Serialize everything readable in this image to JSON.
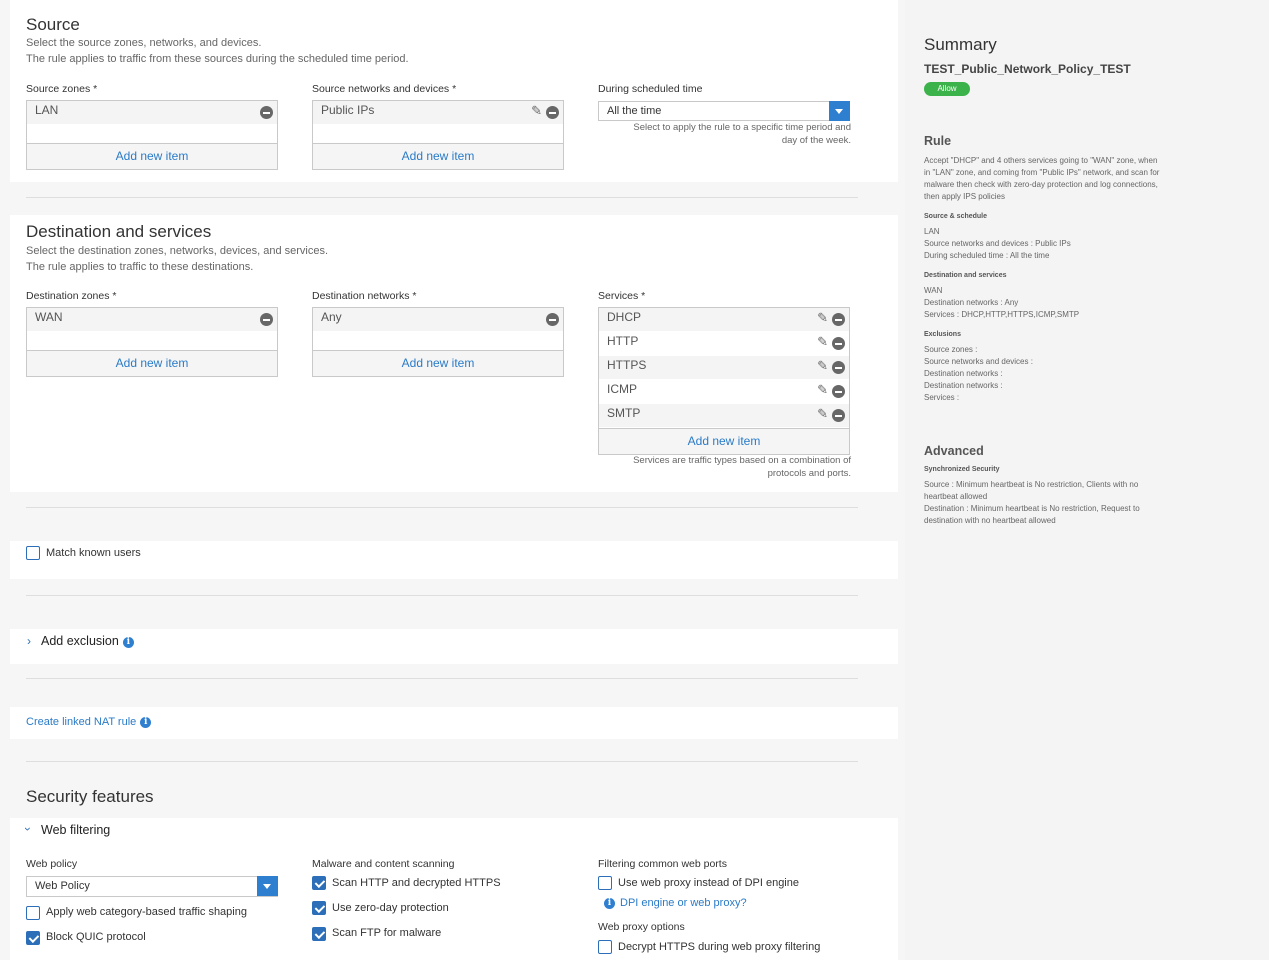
{
  "source": {
    "title": "Source",
    "desc1": "Select the source zones, networks, and devices.",
    "desc2": "The rule applies to traffic from these sources during the scheduled time period.",
    "zones_label": "Source zones *",
    "zones": [
      "LAN"
    ],
    "networks_label": "Source networks and devices *",
    "networks": [
      "Public IPs"
    ],
    "schedule_label": "During scheduled time",
    "schedule_value": "All the time",
    "schedule_hint": "Select to apply the rule to a specific time period and day of the week.",
    "add_new": "Add new item"
  },
  "destination": {
    "title": "Destination and services",
    "desc1": "Select the destination zones, networks, devices, and services.",
    "desc2": "The rule applies to traffic to these destinations.",
    "zones_label": "Destination zones *",
    "zones": [
      "WAN"
    ],
    "networks_label": "Destination networks *",
    "networks": [
      "Any"
    ],
    "services_label": "Services *",
    "services": [
      "DHCP",
      "HTTP",
      "HTTPS",
      "ICMP",
      "SMTP"
    ],
    "services_hint": "Services are traffic types based on a combination of protocols and ports.",
    "add_new": "Add new item"
  },
  "match_known_users": {
    "label": "Match known users",
    "checked": false
  },
  "exclusion": {
    "label": "Add exclusion"
  },
  "nat": {
    "label": "Create linked NAT rule"
  },
  "security": {
    "title": "Security features",
    "web_filtering": "Web filtering",
    "web_policy_label": "Web policy",
    "web_policy_value": "Web Policy",
    "apply_shaping": "Apply web category-based traffic shaping",
    "block_quic": "Block QUIC protocol",
    "malware_label": "Malware and content scanning",
    "scan_http": "Scan HTTP and decrypted HTTPS",
    "zero_day": "Use zero-day protection",
    "scan_ftp": "Scan FTP for malware",
    "ports_label": "Filtering common web ports",
    "use_proxy": "Use web proxy instead of DPI engine",
    "dpi_link": "DPI engine or web proxy?",
    "proxy_options_label": "Web proxy options",
    "decrypt_https": "Decrypt HTTPS during web proxy filtering"
  },
  "summary": {
    "title": "Summary",
    "rule_name": "TEST_Public_Network_Policy_TEST",
    "badge": "Allow",
    "rule_heading": "Rule",
    "rule_text": "Accept \"DHCP\" and 4 others services going to \"WAN\" zone, when in \"LAN\" zone, and coming from \"Public IPs\" network, and scan for malware then check with zero-day protection and log connections, then apply IPS policies",
    "src_sched_heading": "Source & schedule",
    "src_lines": [
      "LAN",
      "Source networks and devices : Public IPs",
      "During scheduled time : All the time"
    ],
    "dst_heading": "Destination and services",
    "dst_lines": [
      "WAN",
      "Destination networks : Any",
      "Services : DHCP,HTTP,HTTPS,ICMP,SMTP"
    ],
    "excl_heading": "Exclusions",
    "excl_lines": [
      "Source zones :",
      "Source networks and devices :",
      "Destination networks :",
      "Destination networks :",
      "Services :"
    ],
    "advanced_heading": "Advanced",
    "sync_heading": "Synchronized Security",
    "sync_source": "Source : Minimum heartbeat is No restriction, Clients with no heartbeat allowed",
    "sync_dest": "Destination : Minimum heartbeat is No restriction, Request to destination with no heartbeat allowed"
  },
  "colors": {
    "accent": "#2f7fd0",
    "link": "#2a7bc7",
    "allow": "#3bb34a"
  }
}
